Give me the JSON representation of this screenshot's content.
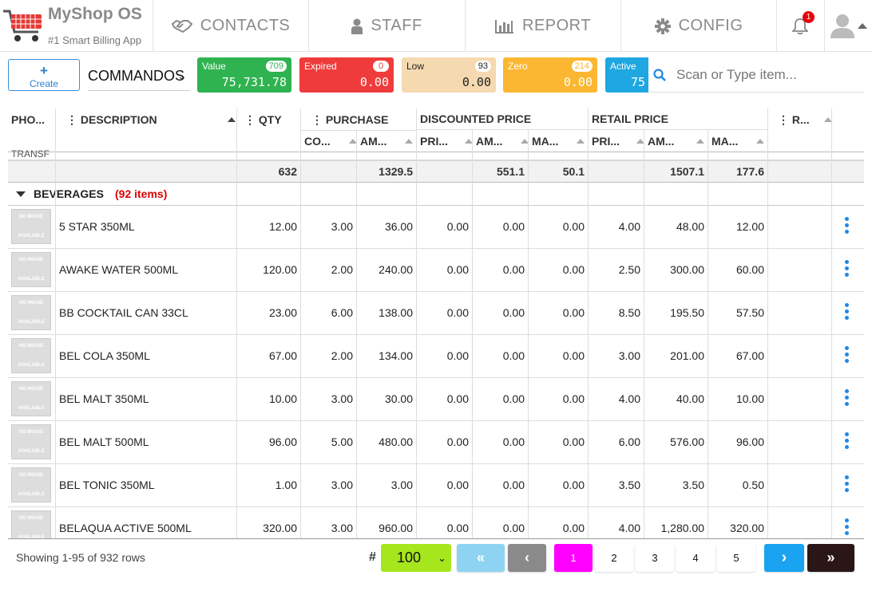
{
  "app": {
    "title": "MyShop OS",
    "subtitle": "#1 Smart Billing App"
  },
  "nav": [
    {
      "label": "CONTACTS",
      "icon": "handshake-icon"
    },
    {
      "label": "STAFF",
      "icon": "user-icon"
    },
    {
      "label": "REPORT",
      "icon": "bar-chart-icon"
    },
    {
      "label": "CONFIG",
      "icon": "gear-icon"
    }
  ],
  "notifications": {
    "count": "1"
  },
  "toolbar": {
    "create_label": "Create",
    "create_plus": "+",
    "dropdown_value": "COMMANDOS",
    "search_placeholder": "Scan or Type item..."
  },
  "cards": [
    {
      "label": "Value",
      "badge": "709",
      "value": "75,731.78",
      "color": "#2fb350"
    },
    {
      "label": "Expired",
      "badge": "0",
      "value": "0.00",
      "color": "#ef3b3b"
    },
    {
      "label": "Low",
      "badge": "93",
      "value": "0.00",
      "color": "#f5d9b0"
    },
    {
      "label": "Zero",
      "badge": "214",
      "value": "0.00",
      "color": "#fbb731"
    },
    {
      "label": "Active",
      "badge": "",
      "value": "75",
      "color": "#1ea7e1"
    }
  ],
  "columns": {
    "photo": "PHO...",
    "description": "DESCRIPTION",
    "qty": "QTY",
    "purchase": "PURCHASE",
    "discounted": "DISCOUNTED PRICE",
    "retail": "RETAIL PRICE",
    "r": "R...",
    "co": "CO...",
    "am": "AM...",
    "pri": "PRI...",
    "ma": "MA..."
  },
  "partial_text": "TRANSF",
  "totals": {
    "qty": "632",
    "purchase_amount": "1329.5",
    "disc_amount": "551.1",
    "disc_margin": "50.1",
    "retail_amount": "1507.1",
    "retail_margin": "177.6"
  },
  "group": {
    "name": "BEVERAGES",
    "count": "(92 items)"
  },
  "no_image": {
    "line1": "NO IMAGE",
    "line2": "AVAILABLE"
  },
  "rows": [
    {
      "desc": "5 STAR 350ML",
      "qty": "12.00",
      "cost": "3.00",
      "pamt": "36.00",
      "dpri": "0.00",
      "damt": "0.00",
      "dma": "0.00",
      "rpri": "4.00",
      "ramt": "48.00",
      "rma": "12.00"
    },
    {
      "desc": "AWAKE WATER 500ML",
      "qty": "120.00",
      "cost": "2.00",
      "pamt": "240.00",
      "dpri": "0.00",
      "damt": "0.00",
      "dma": "0.00",
      "rpri": "2.50",
      "ramt": "300.00",
      "rma": "60.00"
    },
    {
      "desc": "BB COCKTAIL CAN 33CL",
      "qty": "23.00",
      "cost": "6.00",
      "pamt": "138.00",
      "dpri": "0.00",
      "damt": "0.00",
      "dma": "0.00",
      "rpri": "8.50",
      "ramt": "195.50",
      "rma": "57.50"
    },
    {
      "desc": "BEL COLA 350ML",
      "qty": "67.00",
      "cost": "2.00",
      "pamt": "134.00",
      "dpri": "0.00",
      "damt": "0.00",
      "dma": "0.00",
      "rpri": "3.00",
      "ramt": "201.00",
      "rma": "67.00"
    },
    {
      "desc": "BEL MALT 350ML",
      "qty": "10.00",
      "cost": "3.00",
      "pamt": "30.00",
      "dpri": "0.00",
      "damt": "0.00",
      "dma": "0.00",
      "rpri": "4.00",
      "ramt": "40.00",
      "rma": "10.00"
    },
    {
      "desc": "BEL MALT 500ML",
      "qty": "96.00",
      "cost": "5.00",
      "pamt": "480.00",
      "dpri": "0.00",
      "damt": "0.00",
      "dma": "0.00",
      "rpri": "6.00",
      "ramt": "576.00",
      "rma": "96.00"
    },
    {
      "desc": "BEL TONIC 350ML",
      "qty": "1.00",
      "cost": "3.00",
      "pamt": "3.00",
      "dpri": "0.00",
      "damt": "0.00",
      "dma": "0.00",
      "rpri": "3.50",
      "ramt": "3.50",
      "rma": "0.50"
    },
    {
      "desc": "BELAQUA ACTIVE 500ML",
      "qty": "320.00",
      "cost": "3.00",
      "pamt": "960.00",
      "dpri": "0.00",
      "damt": "0.00",
      "dma": "0.00",
      "rpri": "4.00",
      "ramt": "1,280.00",
      "rma": "320.00"
    }
  ],
  "footer": {
    "showing": "Showing 1-95 of 932 rows",
    "hash": "#",
    "per_page": "100",
    "pages": [
      "1",
      "2",
      "3",
      "4",
      "5"
    ],
    "active_page_color": "#ff00ff"
  }
}
